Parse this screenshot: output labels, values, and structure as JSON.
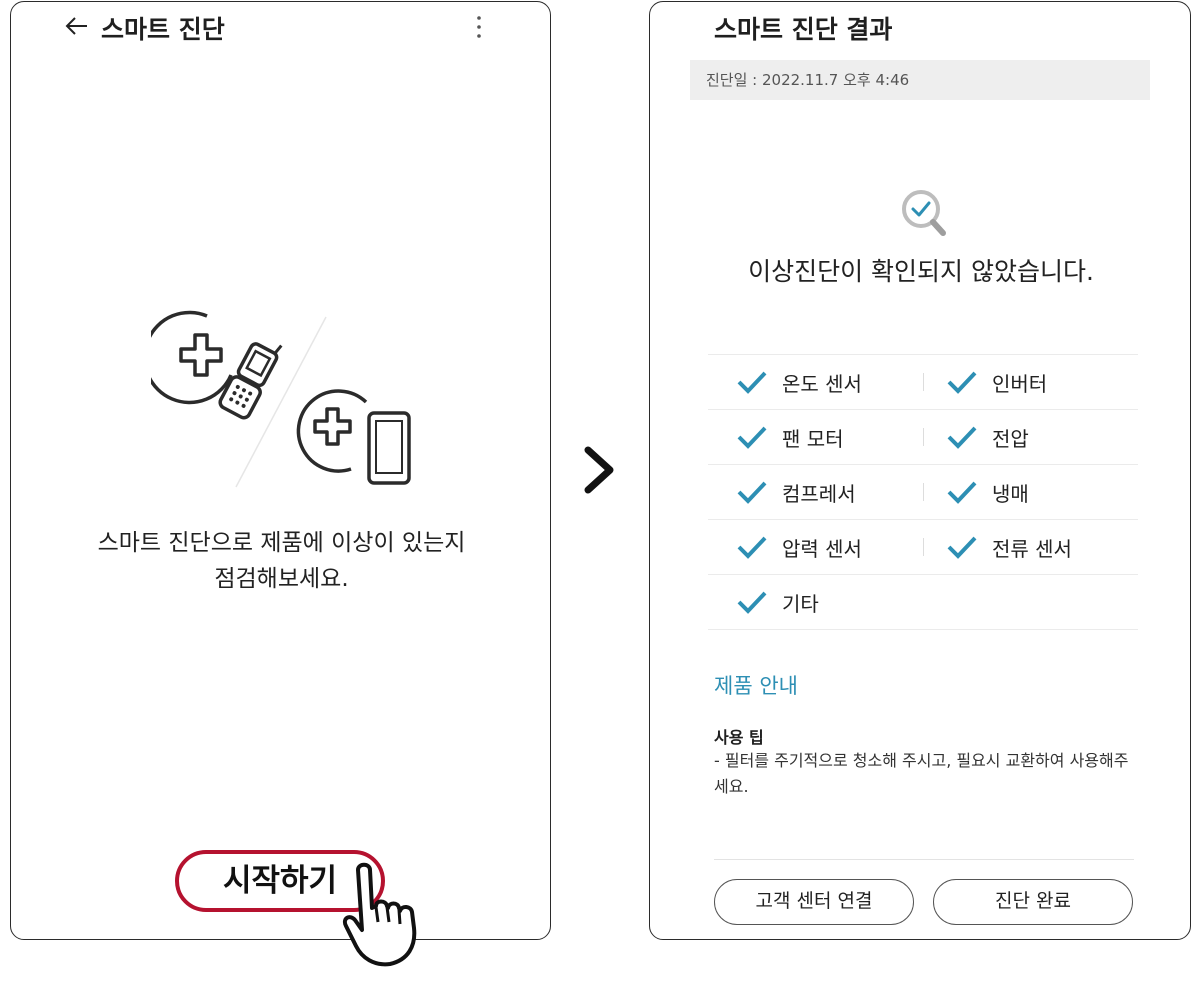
{
  "left_screen": {
    "title": "스마트 진단",
    "description_line1": "스마트 진단으로 제품에 이상이 있는지",
    "description_line2": "점검해보세요.",
    "start_button": "시작하기"
  },
  "right_screen": {
    "title": "스마트 진단 결과",
    "diagnosis_date": "진단일 : 2022.11.7 오후 4:46",
    "result_message": "이상진단이 확인되지 않았습니다.",
    "checks": [
      [
        "온도 센서",
        "인버터"
      ],
      [
        "팬 모터",
        "전압"
      ],
      [
        "컴프레서",
        "냉매"
      ],
      [
        "압력 센서",
        "전류 센서"
      ],
      [
        "기타",
        null
      ]
    ],
    "section_title": "제품 안내",
    "tip_title": "사용 팁",
    "tip_text": "- 필터를 주기적으로 청소해 주시고, 필요시 교환하여 사용해주세요.",
    "buttons": {
      "contact": "고객 센터 연결",
      "done": "진단 완료"
    }
  },
  "colors": {
    "accent_red": "#b5122f",
    "check_blue": "#2d8fb4"
  }
}
